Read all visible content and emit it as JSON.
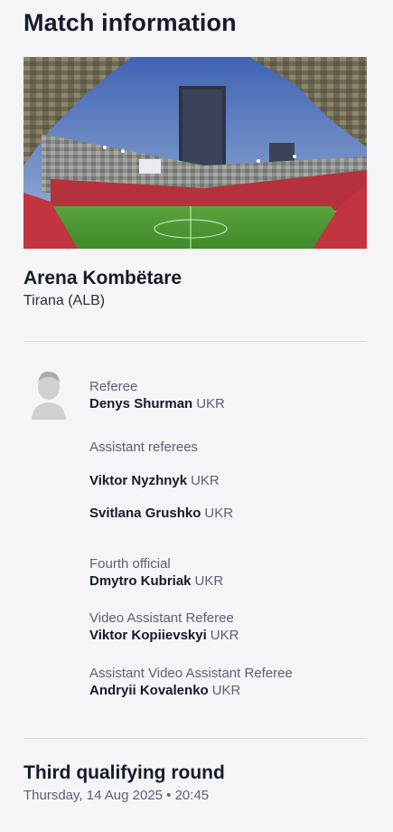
{
  "header": {
    "title": "Match information"
  },
  "venue": {
    "image_alt": "stadium-photo",
    "name": "Arena Kombëtare",
    "city": "Tirana (ALB)"
  },
  "officials": [
    {
      "role": "Referee",
      "name": "Denys Shurman",
      "nationality": "UKR"
    },
    {
      "role": "Assistant referees",
      "name": "",
      "nationality": ""
    },
    {
      "role": "",
      "name": "Viktor Nyzhnyk",
      "nationality": "UKR"
    },
    {
      "role": "",
      "name": "Svitlana Grushko",
      "nationality": "UKR"
    },
    {
      "role": "Fourth official",
      "name": "Dmytro Kubriak",
      "nationality": "UKR"
    },
    {
      "role": "Video Assistant Referee",
      "name": "Viktor Kopiievskyi",
      "nationality": "UKR"
    },
    {
      "role": "Assistant Video Assistant Referee",
      "name": "Andryii Kovalenko",
      "nationality": "UKR"
    }
  ],
  "avatar_icon": "person-silhouette-icon",
  "round": {
    "title": "Third qualifying round",
    "datetime": "Thursday, 14 Aug 2025 • 20:45"
  }
}
